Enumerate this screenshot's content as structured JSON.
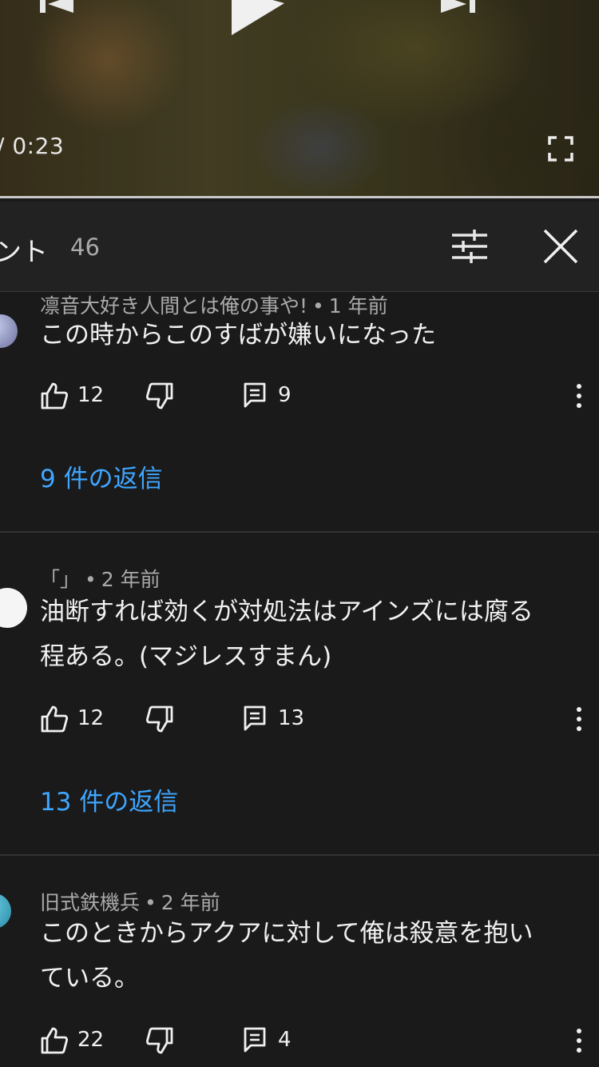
{
  "player": {
    "time_label": "/ 0:23",
    "icons": [
      "previous-icon",
      "play-icon",
      "next-icon",
      "fullscreen-icon"
    ]
  },
  "comments_header": {
    "title": "ント",
    "count": "46",
    "icons": [
      "sort-filter-icon",
      "close-icon"
    ]
  },
  "comments": [
    {
      "author": "凛音大好き人間とは俺の事や!",
      "age": "1 年前",
      "text": "この時からこのすばが嫌いになった",
      "likes": "12",
      "replies_count": "9",
      "replies_link": "9 件の返信",
      "avatar_color": "#8a8fb8"
    },
    {
      "author": "「」",
      "age": "2 年前",
      "text": "油断すれば効くが対処法はアインズには腐る\n程ある。(マジレスすまん)",
      "likes": "12",
      "replies_count": "13",
      "replies_link": "13 件の返信",
      "avatar_color": "#f5f5f5"
    },
    {
      "author": "旧式鉄機兵",
      "age": "2 年前",
      "text": "このときからアクアに対して俺は殺意を抱い\nている。",
      "likes": "22",
      "replies_count": "4",
      "replies_link": "",
      "avatar_color": "#3aa6c4"
    }
  ],
  "colors": {
    "background": "#1a1a1a",
    "header_background": "#222222",
    "link": "#3ea6ff",
    "meta_text": "#aaaaaa"
  }
}
